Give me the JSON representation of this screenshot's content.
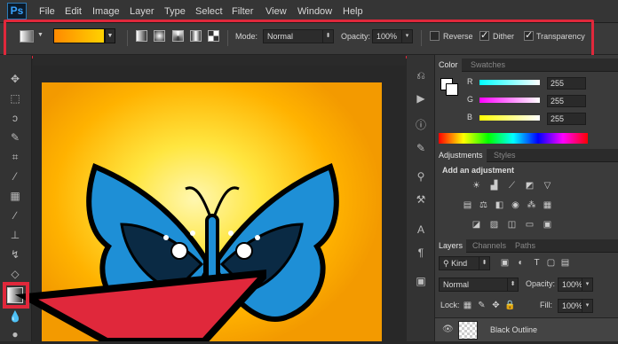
{
  "app": {
    "logo": "Ps"
  },
  "menu": [
    "File",
    "Edit",
    "Image",
    "Layer",
    "Type",
    "Select",
    "Filter",
    "View",
    "Window",
    "Help"
  ],
  "options": {
    "mode_label": "Mode:",
    "mode_value": "Normal",
    "opacity_label": "Opacity:",
    "opacity_value": "100%",
    "reverse_label": "Reverse",
    "dither_label": "Dither",
    "transparency_label": "Transparency",
    "reverse_checked": false,
    "dither_checked": true,
    "transparency_checked": true,
    "gradient_colors": [
      "#ff8a00",
      "#ffd200"
    ]
  },
  "color_panel": {
    "tabs": [
      "Color",
      "Swatches"
    ],
    "r_label": "R",
    "g_label": "G",
    "b_label": "B",
    "r_value": "255",
    "g_value": "255",
    "b_value": "255"
  },
  "adjustments_panel": {
    "tabs": [
      "Adjustments",
      "Styles"
    ],
    "heading": "Add an adjustment"
  },
  "layers_panel": {
    "tabs": [
      "Layers",
      "Channels",
      "Paths"
    ],
    "kind_label": "Kind",
    "blend_mode": "Normal",
    "opacity_label": "Opacity:",
    "opacity_value": "100%",
    "lock_label": "Lock:",
    "fill_label": "Fill:",
    "fill_value": "100%",
    "layer_name": "Black Outline"
  },
  "colors": {
    "highlight": "#e0283b",
    "accent_blue": "#2fa4e7"
  }
}
